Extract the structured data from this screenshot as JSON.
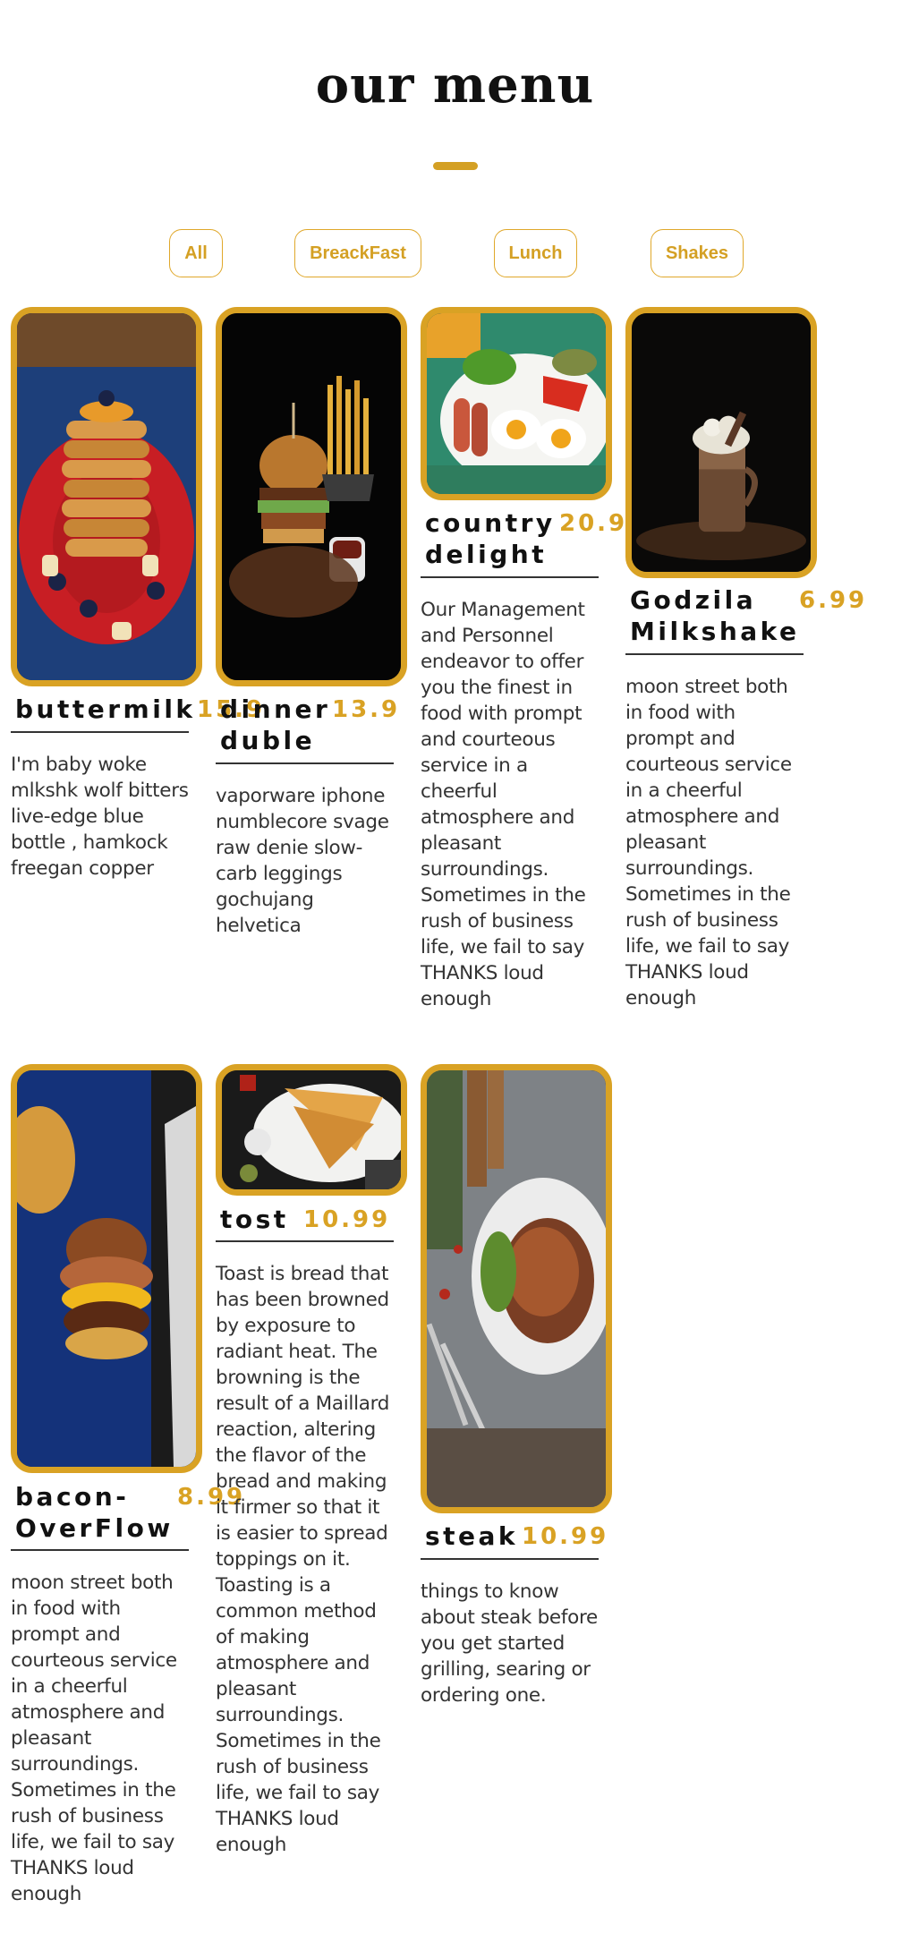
{
  "header": {
    "title": "our menu"
  },
  "filters": [
    "All",
    "BreackFast",
    "Lunch",
    "Shakes"
  ],
  "items": [
    {
      "name": "buttermilk",
      "price": "15.9",
      "image": "pancake-stack-photo",
      "desc": "I'm baby woke mlkshk wolf bitters live-edge blue bottle , hamkock freegan copper"
    },
    {
      "name": "dinner duble",
      "price": "13.9",
      "image": "burger-and-fries-photo",
      "desc": "vaporware iphone numblecore svage raw denie slow-carb leggings gochujang helvetica"
    },
    {
      "name": "country delight",
      "price": "20.9",
      "image": "fried-eggs-breakfast-photo",
      "desc": "Our Management and Personnel endeavor to offer you the finest in food with prompt and courteous service in a cheerful atmosphere and pleasant surroundings. Sometimes in the rush of business life, we fail to say THANKS loud enough"
    },
    {
      "name": "Godzila Milkshake",
      "price": "6.99",
      "image": "chocolate-milkshake-photo",
      "desc": "moon street both in food with prompt and courteous service in a cheerful atmosphere and pleasant surroundings. Sometimes in the rush of business life, we fail to say THANKS loud enough"
    },
    {
      "name": "bacon-OverFlow",
      "price": "8.99",
      "image": "bacon-burger-photo",
      "desc": "moon street both in food with prompt and courteous service in a cheerful atmosphere and pleasant surroundings. Sometimes in the rush of business life, we fail to say THANKS loud enough"
    },
    {
      "name": "tost",
      "price": "10.99",
      "image": "toast-sandwich-photo",
      "desc": "Toast is bread that has been browned by exposure to radiant heat. The browning is the result of a Maillard reaction, altering the flavor of the bread and making it firmer so that it is easier to spread toppings on it. Toasting is a common method of making atmosphere and pleasant surroundings. Sometimes in the rush of business life, we fail to say THANKS loud enough"
    },
    {
      "name": "steak",
      "price": "10.99",
      "image": "grilled-steak-plate-photo",
      "desc": "things to know about steak before you get started grilling, searing or ordering one."
    }
  ],
  "colors": {
    "accent": "#d9a224",
    "text": "#333333",
    "heading": "#111111"
  }
}
